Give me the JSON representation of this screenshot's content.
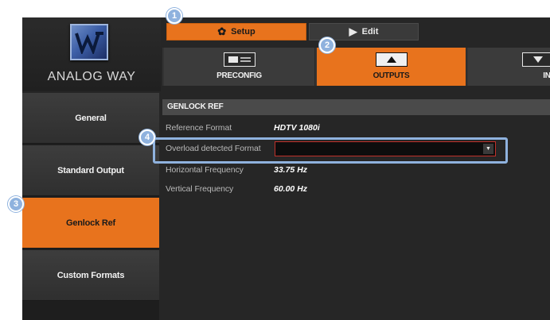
{
  "brand": {
    "logo_text": "ANALOG WAY"
  },
  "modes": {
    "setup_label": "Setup",
    "edit_label": "Edit"
  },
  "tabs": [
    {
      "label": "PRECONFIG",
      "icon": "preconfig-icon"
    },
    {
      "label": "OUTPUTS",
      "icon": "outputs-icon"
    },
    {
      "label": "INPU",
      "icon": "inputs-icon"
    }
  ],
  "sidebar": {
    "items": [
      {
        "label": "General"
      },
      {
        "label": "Standard Output"
      },
      {
        "label": "Genlock Ref"
      },
      {
        "label": "Custom Formats"
      }
    ]
  },
  "panel": {
    "header": "GENLOCK REF",
    "reference_format_label": "Reference Format",
    "reference_format_value": "HDTV 1080i",
    "overload_label": "Overload detected Format",
    "overload_value": "",
    "horizontal_label": "Horizontal Frequency",
    "horizontal_value": "33.75 Hz",
    "vertical_label": "Vertical Frequency",
    "vertical_value": "60.00 Hz"
  },
  "callouts": [
    "1",
    "2",
    "3",
    "4"
  ],
  "colors": {
    "accent": "#e8731d",
    "callout": "#8fb2de",
    "background": "#262626"
  }
}
